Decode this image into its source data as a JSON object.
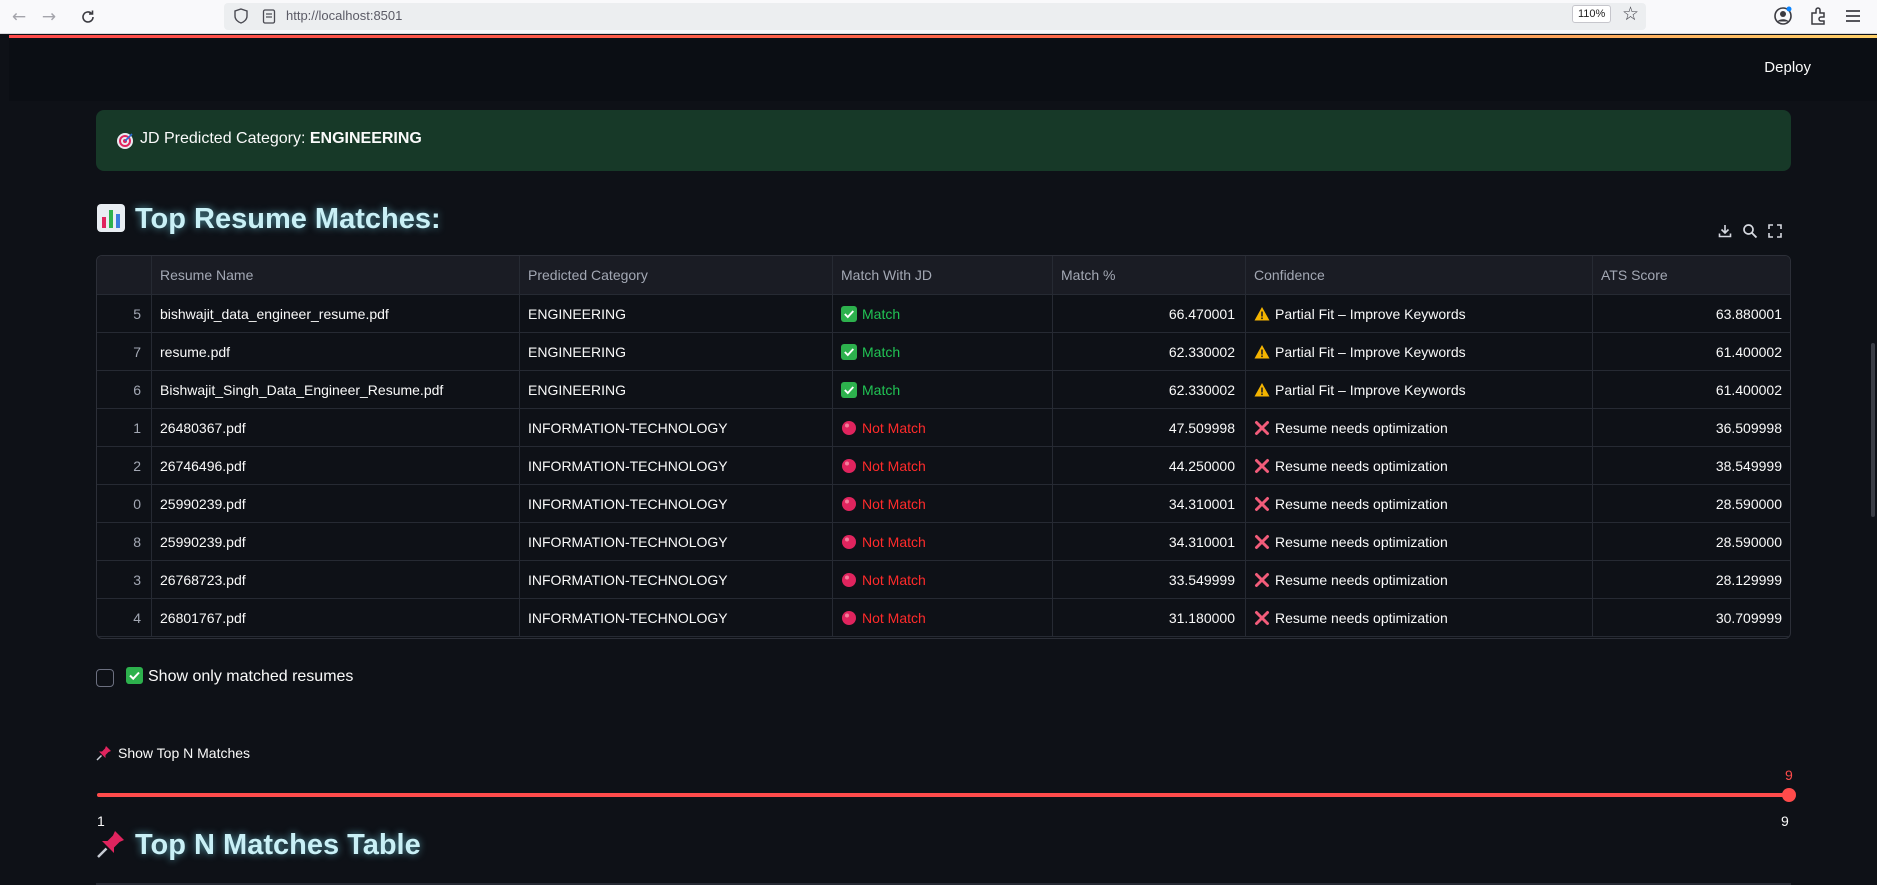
{
  "browser": {
    "url": "http://localhost:8501",
    "zoom": "110%"
  },
  "header": {
    "deploy_label": "Deploy"
  },
  "alert": {
    "prefix": "JD Predicted Category: ",
    "category": "ENGINEERING",
    "icon": "target-icon"
  },
  "section1": {
    "title": "Top Resume Matches:",
    "icon": "bar-chart-icon"
  },
  "table": {
    "columns": [
      "",
      "Resume Name",
      "Predicted Category",
      "Match With JD",
      "Match %",
      "Confidence",
      "ATS Score"
    ],
    "rows": [
      {
        "idx": "5",
        "name": "bishwajit_data_engineer_resume.pdf",
        "category": "ENGINEERING",
        "match": "Match",
        "pct": "66.470001",
        "confidence": "Partial Fit – Improve Keywords",
        "ats": "63.880001"
      },
      {
        "idx": "7",
        "name": "resume.pdf",
        "category": "ENGINEERING",
        "match": "Match",
        "pct": "62.330002",
        "confidence": "Partial Fit – Improve Keywords",
        "ats": "61.400002"
      },
      {
        "idx": "6",
        "name": "Bishwajit_Singh_Data_Engineer_Resume.pdf",
        "category": "ENGINEERING",
        "match": "Match",
        "pct": "62.330002",
        "confidence": "Partial Fit – Improve Keywords",
        "ats": "61.400002"
      },
      {
        "idx": "1",
        "name": "26480367.pdf",
        "category": "INFORMATION-TECHNOLOGY",
        "match": "Not Match",
        "pct": "47.509998",
        "confidence": "Resume needs optimization",
        "ats": "36.509998"
      },
      {
        "idx": "2",
        "name": "26746496.pdf",
        "category": "INFORMATION-TECHNOLOGY",
        "match": "Not Match",
        "pct": "44.250000",
        "confidence": "Resume needs optimization",
        "ats": "38.549999"
      },
      {
        "idx": "0",
        "name": "25990239.pdf",
        "category": "INFORMATION-TECHNOLOGY",
        "match": "Not Match",
        "pct": "34.310001",
        "confidence": "Resume needs optimization",
        "ats": "28.590000"
      },
      {
        "idx": "8",
        "name": "25990239.pdf",
        "category": "INFORMATION-TECHNOLOGY",
        "match": "Not Match",
        "pct": "34.310001",
        "confidence": "Resume needs optimization",
        "ats": "28.590000"
      },
      {
        "idx": "3",
        "name": "26768723.pdf",
        "category": "INFORMATION-TECHNOLOGY",
        "match": "Not Match",
        "pct": "33.549999",
        "confidence": "Resume needs optimization",
        "ats": "28.129999"
      },
      {
        "idx": "4",
        "name": "26801767.pdf",
        "category": "INFORMATION-TECHNOLOGY",
        "match": "Not Match",
        "pct": "31.180000",
        "confidence": "Resume needs optimization",
        "ats": "30.709999"
      }
    ]
  },
  "filter": {
    "checkbox_label": "Show only matched resumes",
    "checked": false
  },
  "slider": {
    "label": "Show Top N Matches",
    "min": 1,
    "max": 9,
    "value": 9,
    "min_label": "1",
    "max_label": "9",
    "value_label": "9"
  },
  "section2": {
    "title": "Top N Matches Table",
    "icon": "pushpin-icon"
  },
  "colors": {
    "background": "#0e1117",
    "accent": "#ff4b4b",
    "match": "#21c354",
    "not_match": "#ff2b2b",
    "alert_bg": "#173928"
  }
}
